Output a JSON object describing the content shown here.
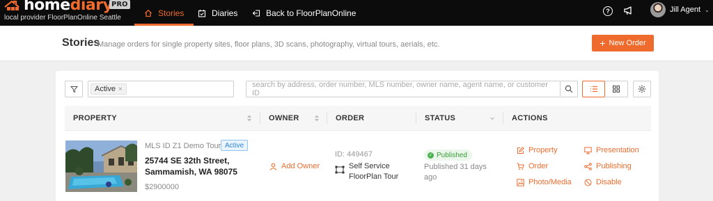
{
  "brand": {
    "logo_word_1": "home",
    "logo_word_2": "diary",
    "logo_badge": "PRO",
    "tagline": "local provider FloorPlanOnline Seattle",
    "accent_color": "#ee6b2d"
  },
  "nav": {
    "tabs": [
      {
        "label": "Stories",
        "icon": "home-icon",
        "active": true
      },
      {
        "label": "Diaries",
        "icon": "calendar-check-icon",
        "active": false
      },
      {
        "label": "Back to FloorPlanOnline",
        "icon": "back-arrow-icon",
        "active": false
      }
    ],
    "help_icon": "?",
    "user_name": "Jill Agent",
    "user_caret": "⌄"
  },
  "header": {
    "title": "Stories",
    "subtitle": "Manage orders for single property sites, floor plans, 3D scans, photography, virtual tours, aerials, etc.",
    "new_order_plus": "+",
    "new_order_label": "New Order"
  },
  "filters": {
    "active_tag": "Active",
    "tag_remove": "×",
    "search_placeholder": "search by address, order number, MLS number, owner name, agent name, or customer ID"
  },
  "table": {
    "columns": [
      "PROPERTY",
      "OWNER",
      "ORDER",
      "STATUS",
      "ACTIONS"
    ],
    "rows": [
      {
        "mls": "MLS ID Z1 Demo Tour",
        "badge": "Active",
        "address_line1": "25744 SE 32th Street,",
        "address_line2": "Sammamish, WA 98075",
        "price": "$2900000",
        "owner_action": "Add Owner",
        "order_id": "ID: 449467",
        "order_name_line1": "Self Service",
        "order_name_line2": "FloorPlan Tour",
        "status_badge": "Published",
        "status_check": "✓",
        "status_text": "Published 31 days ago",
        "actions": [
          {
            "label": "Property",
            "icon": "edit-icon"
          },
          {
            "label": "Order",
            "icon": "cart-icon"
          },
          {
            "label": "Photo/Media",
            "icon": "image-edit-icon"
          },
          {
            "label": "Presentation",
            "icon": "monitor-icon"
          },
          {
            "label": "Publishing",
            "icon": "share-icon"
          },
          {
            "label": "Disable",
            "icon": "ban-icon"
          }
        ]
      }
    ]
  }
}
